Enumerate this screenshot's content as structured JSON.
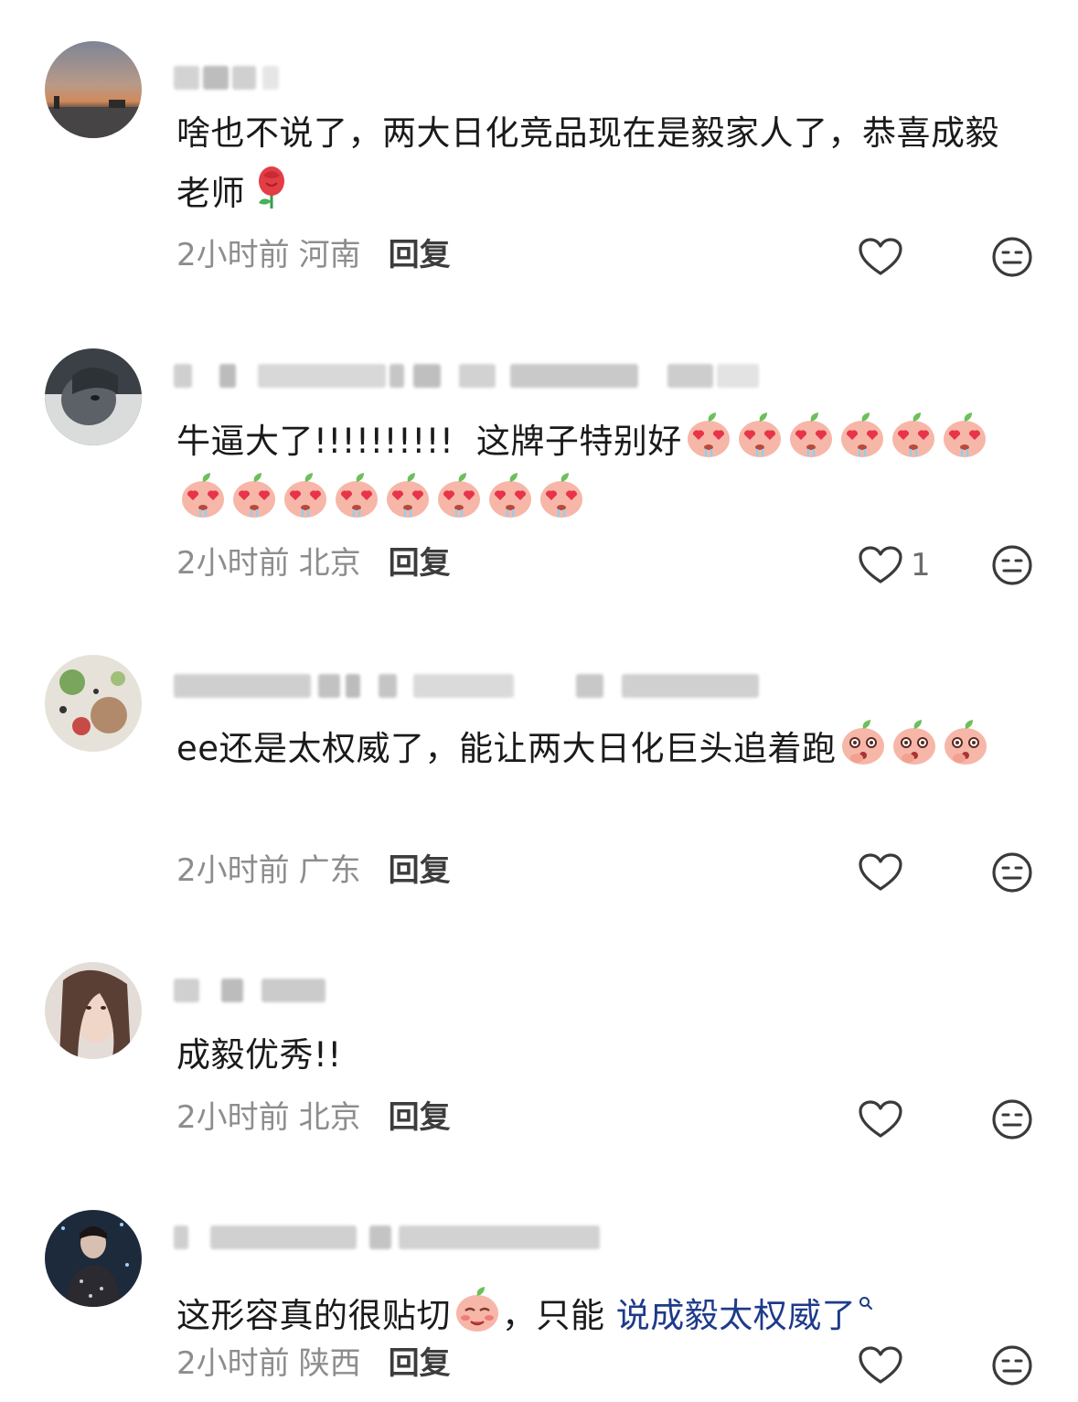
{
  "comments": [
    {
      "text_parts": [
        "啥也不说了，两大日化竞品现在是毅家人了，恭喜成毅老师"
      ],
      "emoji_after": [
        "rose-emoji"
      ],
      "time": "2小时前",
      "location": "河南",
      "reply_label": "回复",
      "like_count": ""
    },
    {
      "text_parts": [
        "牛逼大了!!!!!!!!!!  这牌子特别好"
      ],
      "emoji_after": [
        "heart-eyes-peach-emoji",
        "heart-eyes-peach-emoji",
        "heart-eyes-peach-emoji",
        "heart-eyes-peach-emoji",
        "heart-eyes-peach-emoji",
        "heart-eyes-peach-emoji",
        "heart-eyes-peach-emoji",
        "heart-eyes-peach-emoji",
        "heart-eyes-peach-emoji",
        "heart-eyes-peach-emoji",
        "heart-eyes-peach-emoji",
        "heart-eyes-peach-emoji",
        "heart-eyes-peach-emoji",
        "heart-eyes-peach-emoji"
      ],
      "time": "2小时前",
      "location": "北京",
      "reply_label": "回复",
      "like_count": "1"
    },
    {
      "text_parts": [
        "ee还是太权威了，能让两大日化巨头追着跑"
      ],
      "emoji_after": [
        "shocked-peach-emoji",
        "shocked-peach-emoji",
        "shocked-peach-emoji"
      ],
      "time": "2小时前",
      "location": "广东",
      "reply_label": "回复",
      "like_count": ""
    },
    {
      "text_parts": [
        "成毅优秀!!"
      ],
      "emoji_after": [],
      "time": "2小时前",
      "location": "北京",
      "reply_label": "回复",
      "like_count": ""
    },
    {
      "text_parts": [
        "这形容真的很贴切",
        "，只能 ",
        "说成毅太权威了"
      ],
      "emoji_after": [],
      "inline_emoji": "blushing-peach-emoji",
      "time": "2小时前",
      "location": "陕西",
      "reply_label": "回复",
      "like_count": ""
    }
  ],
  "icons": {
    "like": "heart-outline-icon",
    "dislike": "meh-face-icon",
    "search_link": "search-icon"
  },
  "colors": {
    "link": "#1e3a8a",
    "meta": "#8d8d8d",
    "text": "#1a1a1a"
  }
}
